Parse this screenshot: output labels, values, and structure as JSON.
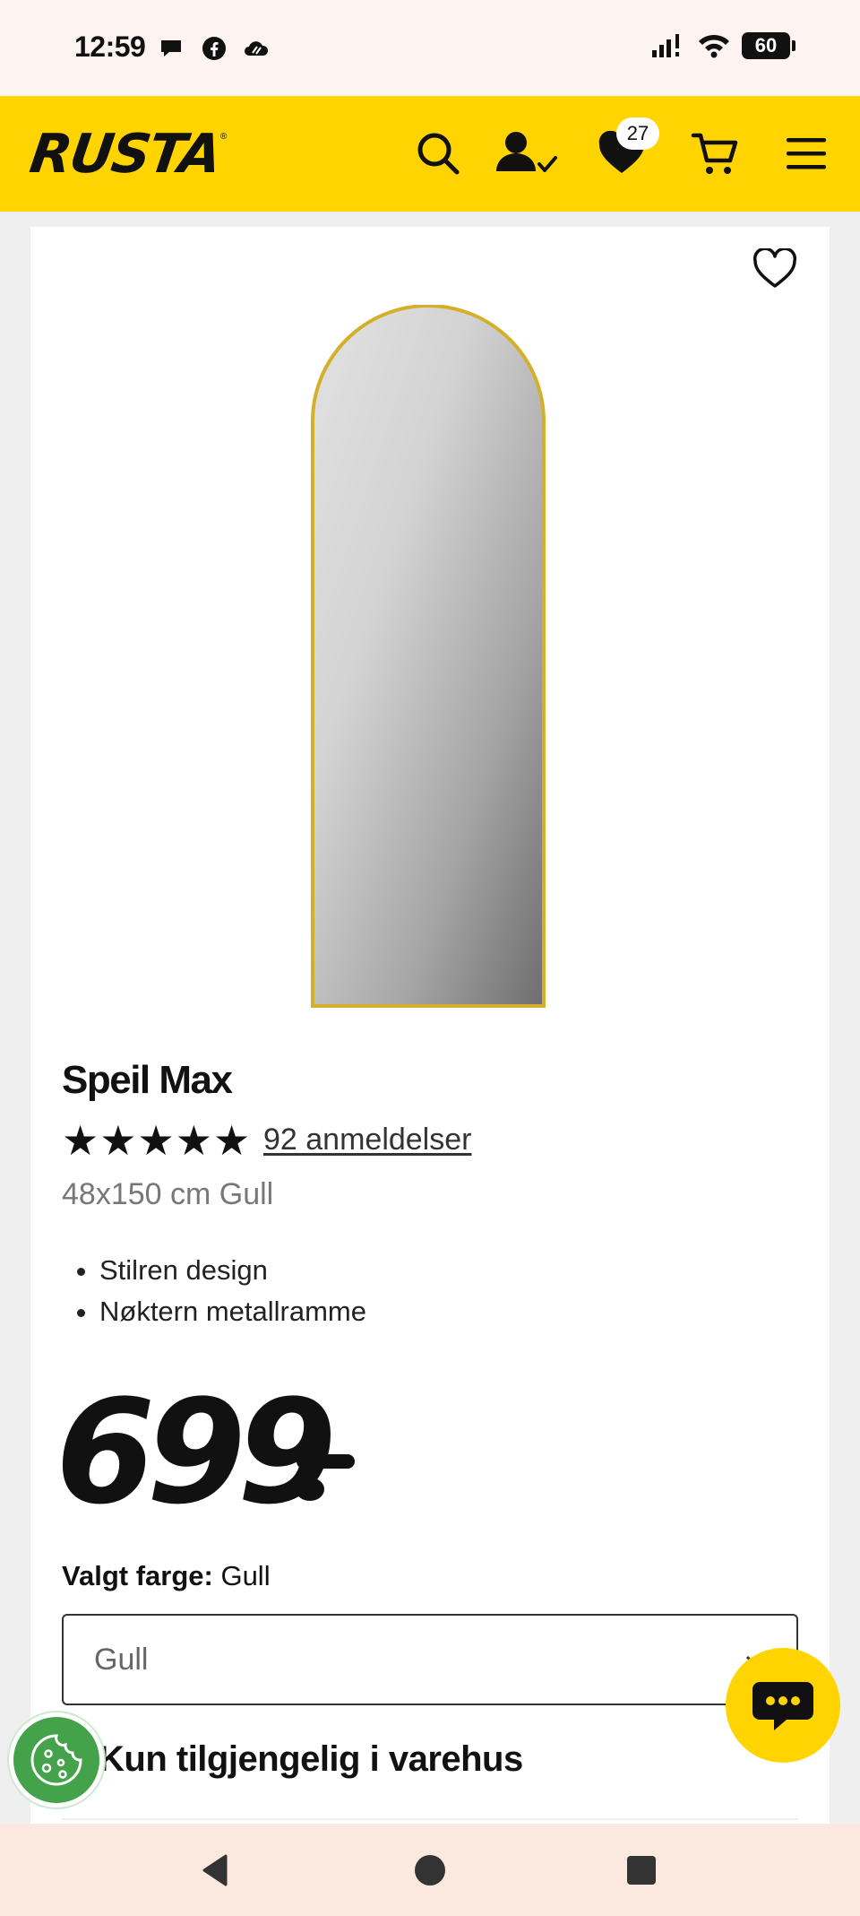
{
  "status_bar": {
    "time": "12:59",
    "battery": "60",
    "icons": [
      "chat-bubble-icon",
      "facebook-icon",
      "cloud-icon",
      "signal-icon",
      "wifi-icon",
      "battery-icon"
    ]
  },
  "header": {
    "logo": "RUSTA",
    "logo_mark": "®",
    "wishlist_count": "27",
    "icons": [
      "search-icon",
      "account-check-icon",
      "heart-icon",
      "cart-icon",
      "menu-icon"
    ],
    "brand_color": "#ffd400"
  },
  "product": {
    "title": "Speil Max",
    "rating": 5,
    "rating_max": 5,
    "reviews_link": "92 anmeldelser",
    "variant": "48x150 cm Gull",
    "bullets": [
      "Stilren design",
      "Nøktern metallramme"
    ],
    "price": "699",
    "color_label": "Valgt farge:",
    "color_value": "Gull",
    "color_select_value": "Gull",
    "availability_heading": "Kun tilgjengelig i varehus",
    "frame_color": "#d4b02a"
  },
  "floating": {
    "chat_icon": "chat-bubble-dots-icon",
    "cookie_icon": "cookie-icon"
  },
  "nav_bar": {
    "icons": [
      "back-icon",
      "home-icon",
      "recents-icon"
    ]
  }
}
